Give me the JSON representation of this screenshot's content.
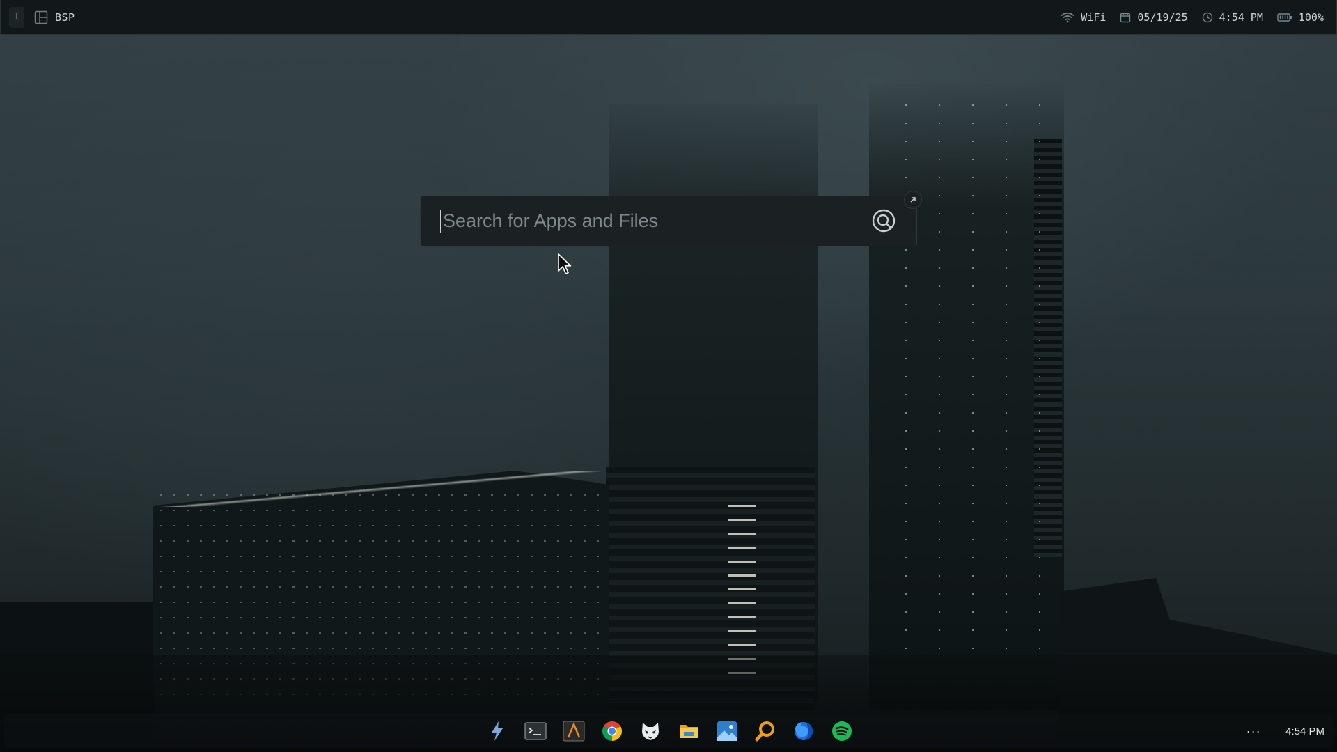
{
  "topbar": {
    "workspace_indicator": "I",
    "layout_label": "BSP",
    "wifi_label": "WiFi",
    "date": "05/19/25",
    "time": "4:54 PM",
    "battery": "100%"
  },
  "launcher": {
    "placeholder": "Search for Apps and Files",
    "value": ""
  },
  "dock": {
    "apps": [
      {
        "name": "Launcher Bolt",
        "icon": "lightning-icon"
      },
      {
        "name": "Terminal",
        "icon": "terminal-icon"
      },
      {
        "name": "Sublime-style Editor",
        "icon": "editor-icon"
      },
      {
        "name": "Chrome",
        "icon": "chrome-icon"
      },
      {
        "name": "Mask App",
        "icon": "mask-icon"
      },
      {
        "name": "Files",
        "icon": "folder-icon"
      },
      {
        "name": "Photos",
        "icon": "photos-icon"
      },
      {
        "name": "Search",
        "icon": "magnifier-icon"
      },
      {
        "name": "Firefox",
        "icon": "firefox-icon"
      },
      {
        "name": "Spotify",
        "icon": "spotify-icon"
      }
    ],
    "tray_more": "···",
    "clock": "4:54 PM"
  },
  "colors": {
    "bar_bg": "#121819",
    "launcher_bg": "#1b2122",
    "accent_teal": "#6f8a90",
    "spotify_green": "#1db954"
  }
}
